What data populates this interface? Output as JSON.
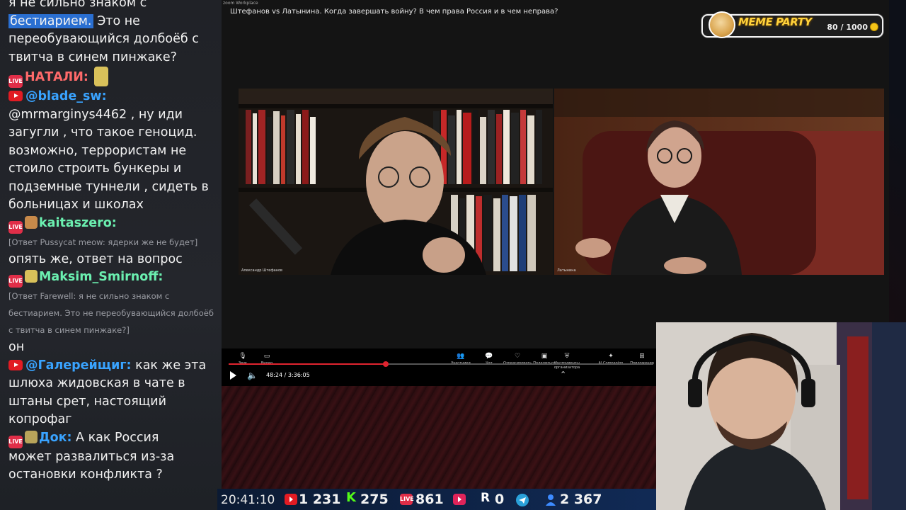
{
  "chat": {
    "messages": [
      {
        "kind": "text",
        "text": "я не сильно знаком с"
      },
      {
        "kind": "text_hl",
        "hl": "бестиарием.",
        "rest": " Это не"
      },
      {
        "kind": "text",
        "text": "переобувающийся долбоёб с"
      },
      {
        "kind": "text",
        "text": "твитча в синем пинжаке?"
      },
      {
        "kind": "name",
        "platform": "live",
        "name": "НАТАЛИ:",
        "name_color": "#ff6a6a"
      },
      {
        "kind": "name",
        "platform": "yt",
        "name": "@blade_sw:",
        "name_color": "#39a3ff"
      },
      {
        "kind": "text",
        "text": "@mrmarginys4462 , ну иди"
      },
      {
        "kind": "text",
        "text": "загугли , что такое геноцид."
      },
      {
        "kind": "text",
        "text": "возможно, террористам не"
      },
      {
        "kind": "text",
        "text": "стоило строить бункеры и"
      },
      {
        "kind": "text",
        "text": "подземные туннели , сидеть в"
      },
      {
        "kind": "text",
        "text": "больницах и школах"
      },
      {
        "kind": "name",
        "platform": "live",
        "name": "kaitaszero:",
        "name_color": "#6bf0b0"
      },
      {
        "kind": "quote",
        "text": "[Ответ Pussycat meow: ядерки же не будет]"
      },
      {
        "kind": "text",
        "text": "опять же, ответ на вопрос"
      },
      {
        "kind": "name",
        "platform": "live",
        "name": "Maksim_Smirnoff:",
        "name_color": "#6bf0b0"
      },
      {
        "kind": "quote",
        "text": "[Ответ Farewell: я не сильно знаком с"
      },
      {
        "kind": "quote",
        "text": "бестиарием.  Это не переобувающийся долбоёб"
      },
      {
        "kind": "quote",
        "text": "с твитча в синем пинжаке?]"
      },
      {
        "kind": "text",
        "text": "он"
      },
      {
        "kind": "inline",
        "platform": "yt",
        "name": "@Галерейщиг:",
        "name_color": "#39a3ff",
        "text": " как же эта"
      },
      {
        "kind": "text",
        "text": "шлюха жидовская в чате в"
      },
      {
        "kind": "text",
        "text": "штаны срет, настоящий"
      },
      {
        "kind": "text",
        "text": "копрофаг"
      },
      {
        "kind": "inline",
        "platform": "live",
        "name": "Док:",
        "name_color": "#39a3ff",
        "text": " А как Россия"
      },
      {
        "kind": "text",
        "text": "может развалиться из-за"
      },
      {
        "kind": "text",
        "text": "остановки конфликта ?"
      }
    ]
  },
  "zoom": {
    "brand": "zoom Workplace",
    "title": "Штефанов vs Латынина. Когда завершать войну? В чем права Россия и в чем неправа?",
    "tile_left_label": "Александр Штефанов",
    "tile_right_label": "Латынина",
    "controls": [
      {
        "label": "Звук",
        "icon": "mic-icon"
      },
      {
        "label": "Видео",
        "icon": "video-icon"
      },
      {
        "label": "Участники",
        "icon": "participants-icon"
      },
      {
        "label": "Чат",
        "icon": "chat-icon"
      },
      {
        "label": "Отреагировать",
        "icon": "heart-icon"
      },
      {
        "label": "Поделиться",
        "icon": "share-icon"
      },
      {
        "label": "Инструменты организатора",
        "icon": "shield-icon"
      },
      {
        "label": "AI Companion",
        "icon": "sparkle-icon"
      },
      {
        "label": "Приложения",
        "icon": "apps-icon"
      }
    ],
    "time": "48:24 / 3:36:05",
    "progress": 0.37
  },
  "meme_party": {
    "title": "MEME PARTY",
    "count": "80 / 1000"
  },
  "statusbar": {
    "clock": "20:41:10",
    "youtube": "1 231",
    "kick": "275",
    "live": "861",
    "rutube": "0",
    "telegram": "",
    "viewers": "2 367"
  },
  "colors": {
    "youtube": "#e21b23",
    "kick": "#53fc18",
    "live": "#e02e48",
    "telegram": "#2aa1da",
    "viewers": "#3d8bff"
  }
}
